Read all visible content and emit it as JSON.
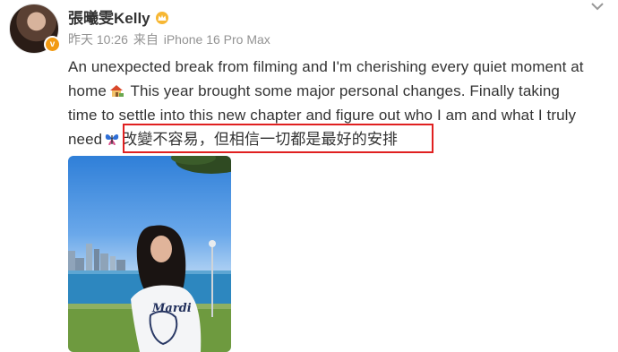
{
  "user": {
    "name": "張曦雯Kelly",
    "crown_icon": "crown-icon",
    "verified_badge": "v"
  },
  "meta": {
    "time": "昨天 10:26",
    "source_prefix": "来自",
    "device": "iPhone 16 Pro Max"
  },
  "post": {
    "line1": "An unexpected break from filming and I'm cherishing every quiet moment at",
    "line2a": "home",
    "house_icon": "house-icon",
    "line2b": "This year brought some major personal changes. Finally taking",
    "line3": "time to settle into this new chapter and figure out who I am and what I truly",
    "line4a": "need",
    "butterfly_icon": "butterfly-icon",
    "chinese": "改變不容易，但相信一切都是最好的安排"
  },
  "photo": {
    "shirt_text": "Mardi"
  },
  "colors": {
    "highlight": "#e02020",
    "meta_gray": "#939393",
    "badge_orange": "#f29a12"
  }
}
